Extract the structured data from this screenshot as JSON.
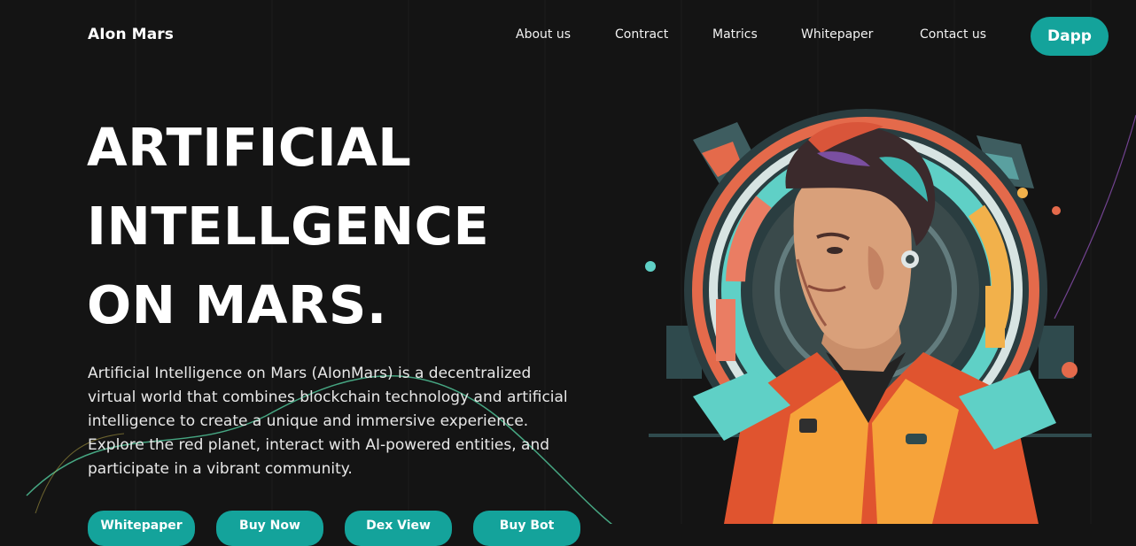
{
  "brand": {
    "name": "AIon Mars"
  },
  "nav": {
    "items": [
      {
        "label": "About us"
      },
      {
        "label": "Contract"
      },
      {
        "label": "Matrics"
      },
      {
        "label": "Whitepaper"
      },
      {
        "label": "Contact us"
      }
    ],
    "dapp_label": "Dapp"
  },
  "hero": {
    "title_lines": [
      "ARTIFICIAL",
      "INTELLGENCE",
      "ON MARS."
    ],
    "description": "Artificial Intelligence on Mars (AIonMars) is a decentralized virtual world that combines blockchain technology and artificial intelligence to create a unique and immersive experience. Explore the red planet, interact with AI-powered entities, and participate in a vibrant community.",
    "buttons": [
      {
        "label": "Whitepaper"
      },
      {
        "label": "Buy Now"
      },
      {
        "label": "Dex View"
      },
      {
        "label": "Buy Bot"
      }
    ]
  },
  "colors": {
    "background": "#141414",
    "accent": "#14a39b",
    "text": "#ffffff"
  },
  "icons": {
    "portrait": "ai-astronaut-portrait"
  }
}
